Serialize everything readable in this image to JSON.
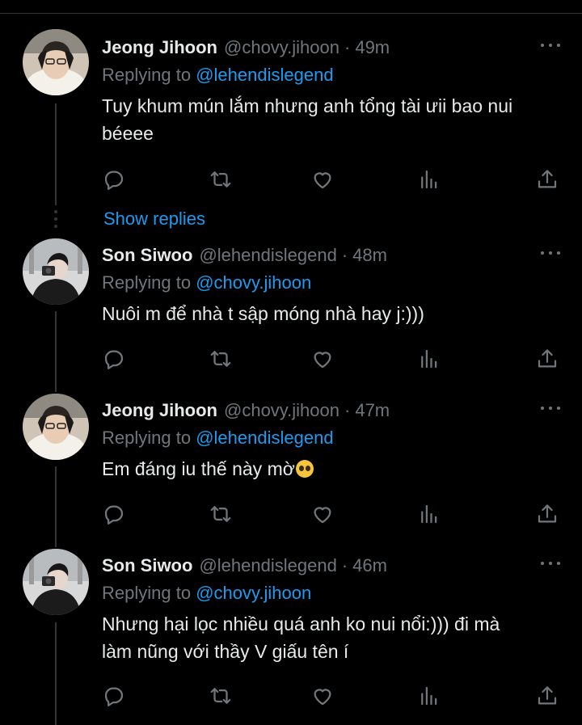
{
  "tweets": [
    {
      "name": "Jeong Jihoon",
      "handle": "@chovy.jihoon",
      "dot": "·",
      "time": "49m",
      "replying_prefix": "Replying to",
      "replying_to": "@lehendislegend",
      "text_lines": [
        "Tuy khum mún lắm nhưng anh tổng tài ưii bao nui",
        "béeee"
      ]
    },
    {
      "name": "Son Siwoo",
      "handle": "@lehendislegend",
      "dot": "·",
      "time": "48m",
      "replying_prefix": "Replying to",
      "replying_to": "@chovy.jihoon",
      "text_lines": [
        "Nuôi m để nhà t sập móng nhà hay j:)))"
      ]
    },
    {
      "name": "Jeong Jihoon",
      "handle": "@chovy.jihoon",
      "dot": "·",
      "time": "47m",
      "replying_prefix": "Replying to",
      "replying_to": "@lehendislegend",
      "text_lines": [
        "Em đáng iu thế này mờ"
      ],
      "emoji": "pleading-face-emoji"
    },
    {
      "name": "Son Siwoo",
      "handle": "@lehendislegend",
      "dot": "·",
      "time": "46m",
      "replying_prefix": "Replying to",
      "replying_to": "@chovy.jihoon",
      "text_lines": [
        "Nhưng hại lọc nhiều quá anh ko nui nổi:))) đi mà",
        "làm nũng với thầy V giấu tên í"
      ]
    }
  ],
  "show_replies": "Show replies",
  "colors": {
    "background": "#000000",
    "text": "#e7e9ea",
    "muted": "#71767b",
    "link": "#1d9bf0",
    "divider": "#2f3336"
  },
  "icons": {
    "actions": [
      "reply-icon",
      "retweet-icon",
      "like-icon",
      "views-icon",
      "share-icon"
    ],
    "more": "more-dots-icon"
  }
}
